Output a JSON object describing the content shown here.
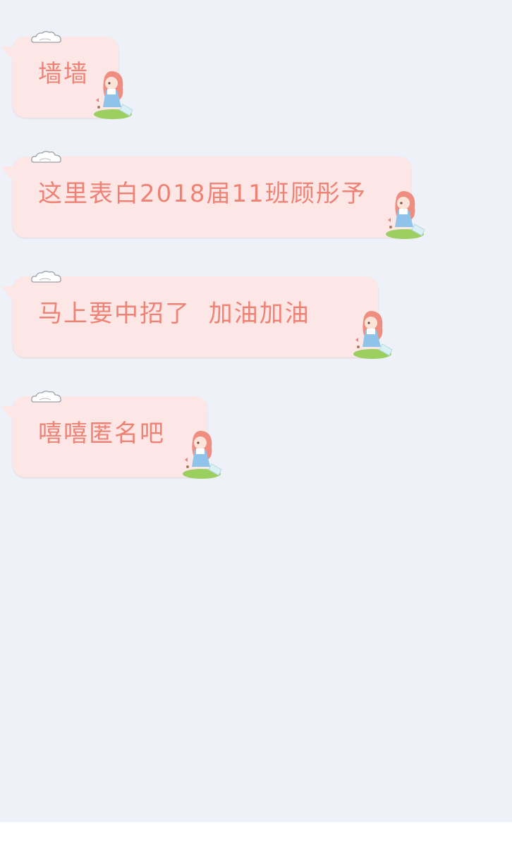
{
  "messages": [
    {
      "text": "墙墙"
    },
    {
      "text": "这里表白2018届11班顾彤予"
    },
    {
      "text": "马上要中招了  加油加油"
    },
    {
      "text": "嘻嘻匿名吧"
    }
  ],
  "colors": {
    "background": "#eef2f8",
    "bubble": "#fde6e6",
    "text": "#ee8375"
  },
  "icons": {
    "cloud": "cloud-icon",
    "sticker": "girl-sticker-icon"
  }
}
